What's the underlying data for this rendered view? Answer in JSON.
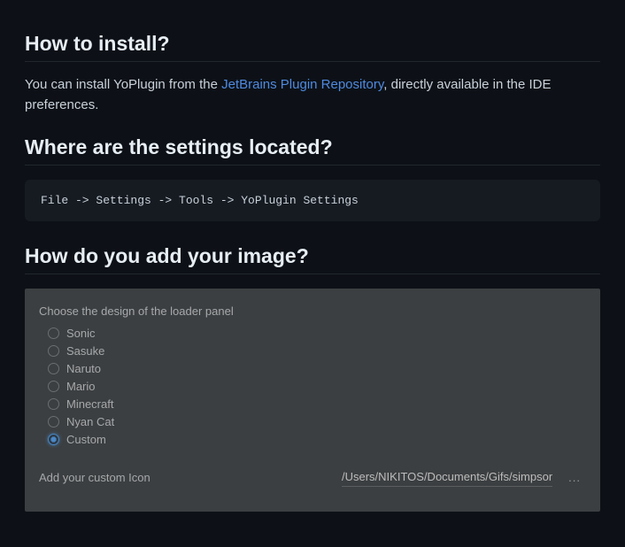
{
  "sections": {
    "install": {
      "heading": "How to install?",
      "text_before": "You can install YoPlugin from the ",
      "link_text": "JetBrains Plugin Repository",
      "text_after": ", directly available in the IDE preferences."
    },
    "settings": {
      "heading": "Where are the settings located?",
      "code": "File -> Settings -> Tools -> YoPlugin Settings"
    },
    "image": {
      "heading": "How do you add your image?"
    }
  },
  "panel": {
    "title": "Choose the design of the loader panel",
    "options": [
      {
        "label": "Sonic",
        "selected": false
      },
      {
        "label": "Sasuke",
        "selected": false
      },
      {
        "label": "Naruto",
        "selected": false
      },
      {
        "label": "Mario",
        "selected": false
      },
      {
        "label": "Minecraft",
        "selected": false
      },
      {
        "label": "Nyan Cat",
        "selected": false
      },
      {
        "label": "Custom",
        "selected": true
      }
    ],
    "custom_label": "Add your custom Icon",
    "custom_path": "/Users/NIKITOS/Documents/Gifs/simpson.gif",
    "browse": "..."
  }
}
